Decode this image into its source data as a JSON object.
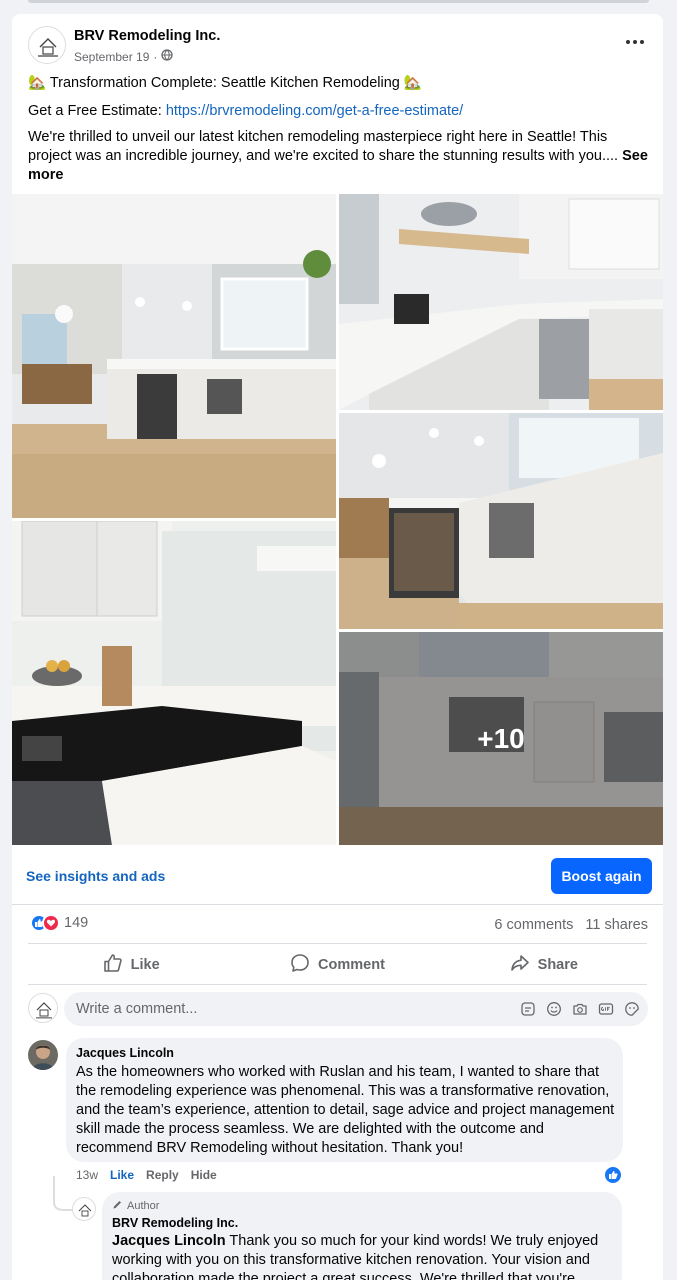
{
  "post": {
    "page_name": "BRV Remodeling Inc.",
    "date": "September 19",
    "separator": "·",
    "title_line": "🏡 Transformation Complete: Seattle Kitchen Remodeling 🏡",
    "estimate_label": "Get a Free Estimate:",
    "estimate_link": "https://brvremodeling.com/get-a-free-estimate/",
    "body": "We're thrilled to unveil our latest kitchen remodeling masterpiece right here in Seattle! This project was an incredible journey, and we're excited to share the stunning results with you....",
    "see_more": "See more",
    "extra_photos": "+10"
  },
  "promo": {
    "insights": "See insights and ads",
    "boost": "Boost again"
  },
  "stats": {
    "reactions": "149",
    "comments": "6 comments",
    "shares": "11 shares"
  },
  "actions": {
    "like": "Like",
    "comment": "Comment",
    "share": "Share"
  },
  "composer": {
    "placeholder": "Write a comment..."
  },
  "comments": [
    {
      "author": "Jacques Lincoln",
      "text": "As the homeowners who worked with Ruslan and his team, I wanted to share that the remodeling experience was phenomenal. This was a transformative renovation, and the team’s experience, attention to detail, sage advice and project management skill made the process seamless. We are delighted with the outcome and recommend BRV Remodeling without hesitation. Thank you!",
      "time": "13w",
      "like": "Like",
      "reply": "Reply",
      "hide": "Hide"
    }
  ],
  "reply": {
    "badge": "Author",
    "author": "BRV Remodeling Inc.",
    "mention": "Jacques Lincoln",
    "text": " Thank you so much for your kind words! We truly enjoyed working with you on this transformative kitchen renovation. Your vision and collaboration made the project a great success. We're thrilled that you're"
  },
  "colors": {
    "link": "#1465c0",
    "boost": "#0866ff",
    "like_blue": "#1877f2",
    "love_red": "#f02849"
  },
  "icons": [
    "house-emoji",
    "globe-icon",
    "more-icon",
    "like-reaction-icon",
    "love-reaction-icon",
    "thumbs-up-icon",
    "comment-icon",
    "share-icon",
    "sticker-icon",
    "emoji-icon",
    "camera-icon",
    "gif-icon",
    "avatar-sticker-icon",
    "pencil-icon"
  ]
}
